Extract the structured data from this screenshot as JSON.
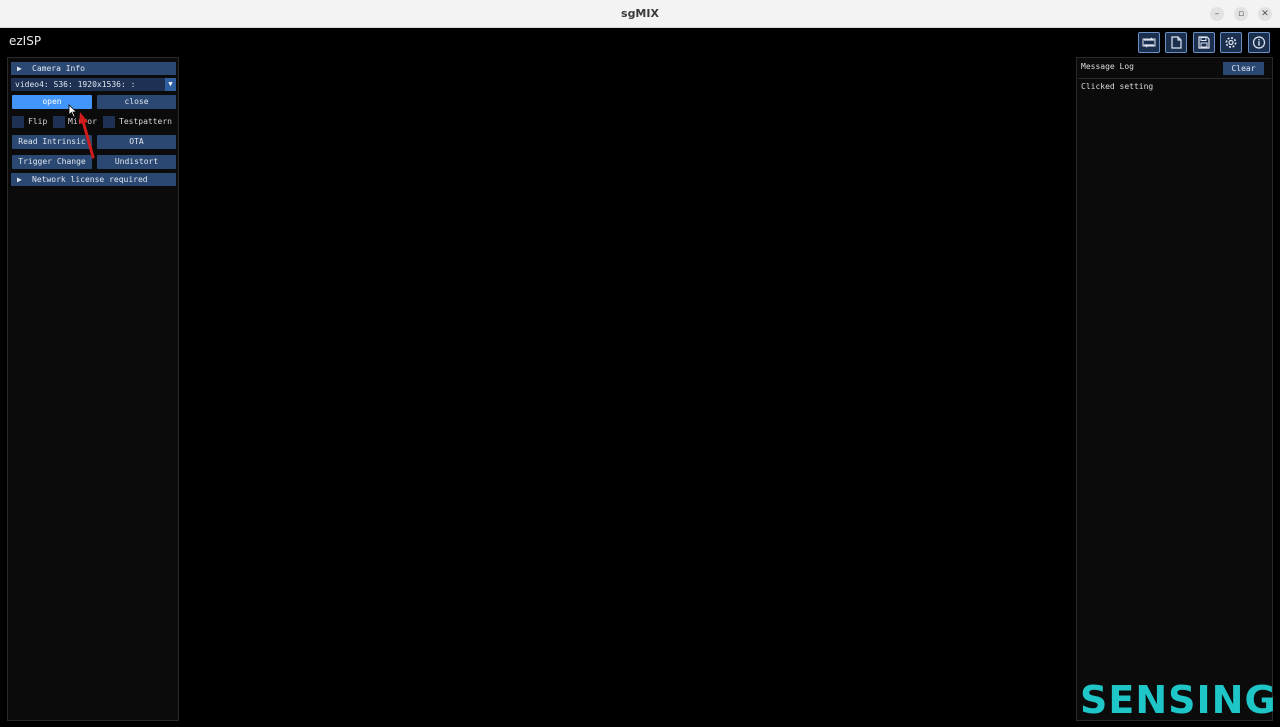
{
  "window": {
    "title": "sgMIX"
  },
  "app": {
    "title": "ezISP"
  },
  "toolbar": {
    "icons": [
      "switch-camera-icon",
      "folder-icon",
      "save-icon",
      "gear-icon",
      "info-icon"
    ]
  },
  "left_panel": {
    "camera_info_label": "Camera Info",
    "camera_select_value": "video4: S36: 1920x1536: :",
    "open_label": "open",
    "close_label": "close",
    "flip_label": "Flip",
    "mirror_label": "Mirror",
    "testpattern_label": "Testpattern",
    "read_intrinsic_label": "Read Intrinsic",
    "ota_label": "OTA",
    "trigger_change_label": "Trigger Change",
    "undistort_label": "Undistort",
    "network_label": "Network license required"
  },
  "message_log": {
    "title": "Message Log",
    "clear_label": "Clear",
    "lines": [
      "Clicked setting"
    ]
  },
  "logo": {
    "text": "SENSING",
    "color": "#1fc6c7"
  },
  "colors": {
    "accent": "#4296fa",
    "button": "#2a4871",
    "frame": "#1e3152"
  }
}
